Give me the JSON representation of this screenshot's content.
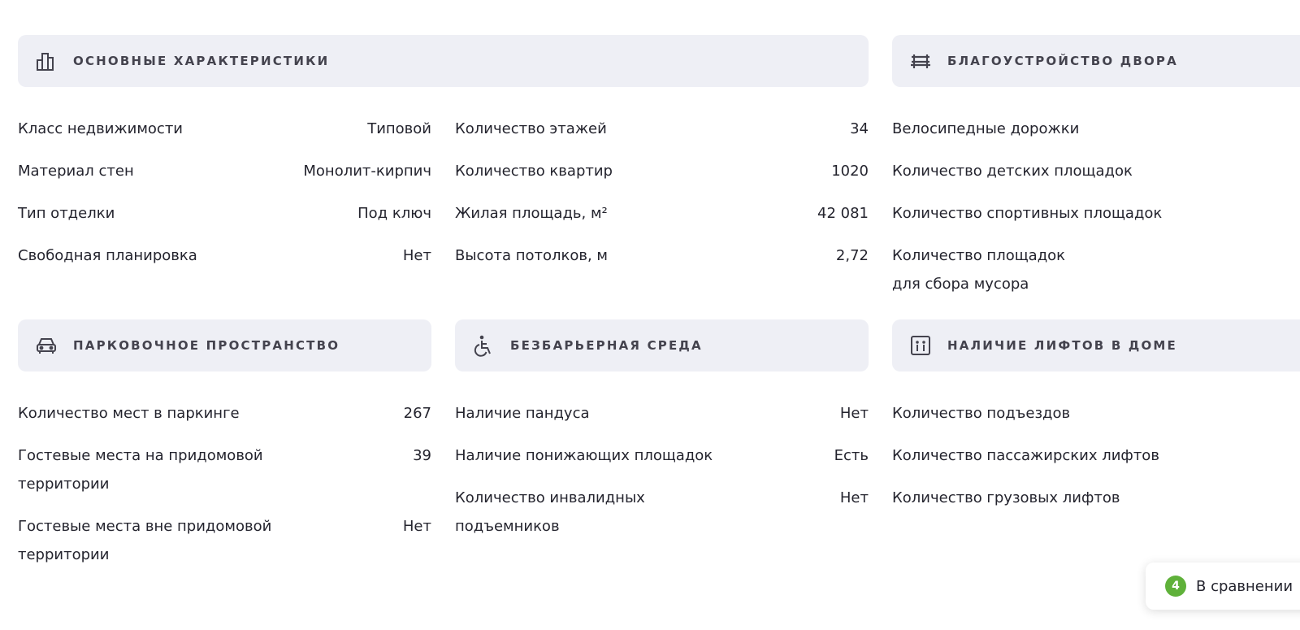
{
  "sections": {
    "main": {
      "title": "Основные характеристики",
      "icon": "bar-chart-icon",
      "left": [
        {
          "label": "Класс недвижимости",
          "value": "Типовой"
        },
        {
          "label": "Материал стен",
          "value": "Монолит-кирпич"
        },
        {
          "label": "Тип отделки",
          "value": "Под ключ"
        },
        {
          "label": "Свободная планировка",
          "value": "Нет"
        }
      ],
      "right": [
        {
          "label": "Количество этажей",
          "value": "34"
        },
        {
          "label": "Количество квартир",
          "value": "1020"
        },
        {
          "label": "Жилая площадь, м²",
          "value": "42 081"
        },
        {
          "label": "Высота потолков, м",
          "value": "2,72"
        }
      ]
    },
    "yard": {
      "title": "Благоустройство двора",
      "icon": "bench-icon",
      "items": [
        {
          "label": "Велосипедные дорожки"
        },
        {
          "label": "Количество детских площадок"
        },
        {
          "label": "Количество спортивных площадок"
        },
        {
          "label": "Количество площадок\nдля сбора мусора"
        }
      ]
    },
    "parking": {
      "title": "Парковочное пространство",
      "icon": "car-icon",
      "items": [
        {
          "label": "Количество мест в паркинге",
          "value": "267"
        },
        {
          "label": "Гостевые места на придомовой\nтерритории",
          "value": "39"
        },
        {
          "label": "Гостевые места вне придомовой\nтерритории",
          "value": "Нет"
        }
      ]
    },
    "accessible": {
      "title": "Безбарьерная среда",
      "icon": "wheelchair-icon",
      "items": [
        {
          "label": "Наличие пандуса",
          "value": "Нет"
        },
        {
          "label": "Наличие понижающих площадок",
          "value": "Есть"
        },
        {
          "label": "Количество инвалидных\nподъемников",
          "value": "Нет"
        }
      ]
    },
    "elevators": {
      "title": "Наличие лифтов в доме",
      "icon": "elevator-icon",
      "items": [
        {
          "label": "Количество подъездов"
        },
        {
          "label": "Количество пассажирских лифтов"
        },
        {
          "label": "Количество грузовых лифтов"
        }
      ]
    }
  },
  "compare": {
    "count": "4",
    "label": "В сравнении"
  },
  "colors": {
    "header_bg": "#eeeff5",
    "text": "#24242e",
    "accent_green": "#5fb13a"
  }
}
